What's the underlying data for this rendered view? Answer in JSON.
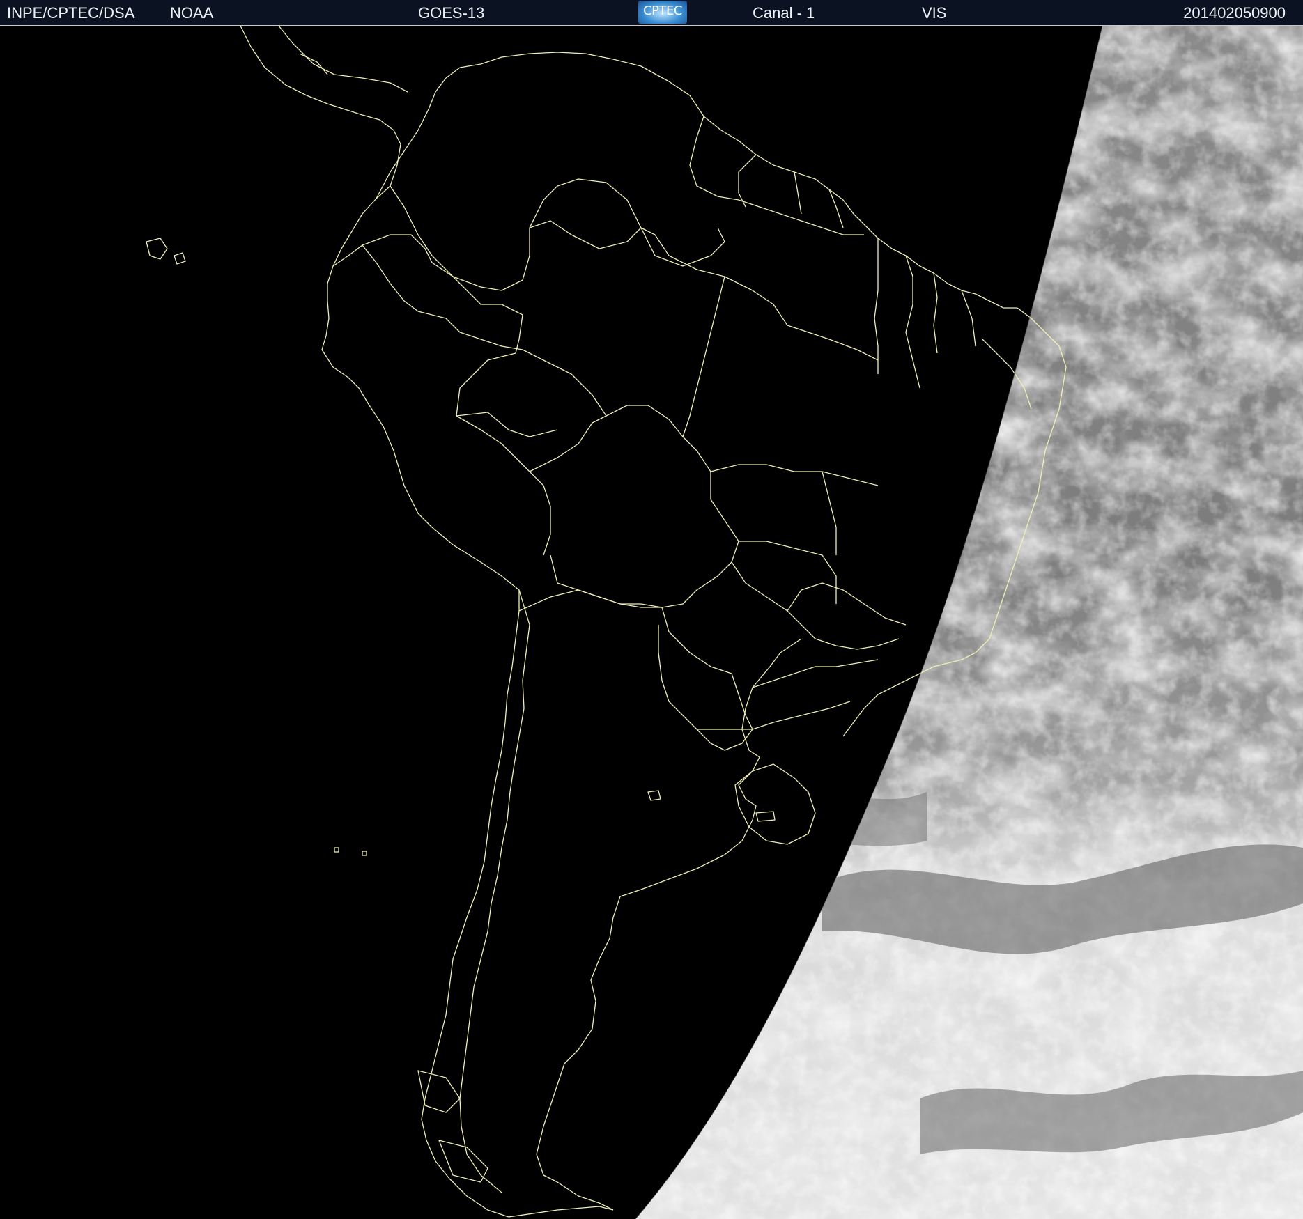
{
  "header": {
    "organization": "INPE/CPTEC/DSA",
    "agency": "NOAA",
    "satellite": "GOES-13",
    "logo_text": "CPTEC",
    "channel": "Canal - 1",
    "band": "VIS",
    "timestamp": "201402050900"
  },
  "colors": {
    "header_bg": "#0b1322",
    "header_text": "#eef2f6",
    "night_side": "#000000",
    "cloud_gray": "#8c8c8c",
    "cloud_bright": "#e6e6e6",
    "coastline": "#f0efb4"
  }
}
